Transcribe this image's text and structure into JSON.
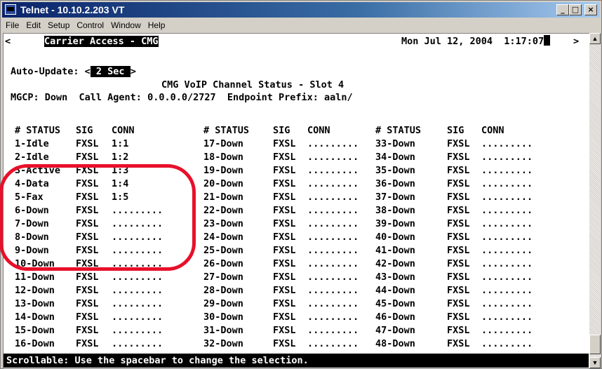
{
  "window": {
    "title": "Telnet - 10.10.2.203 VT",
    "controls": {
      "minimize": "_",
      "maximize": "□",
      "close": "×"
    }
  },
  "menu": [
    "File",
    "Edit",
    "Setup",
    "Control",
    "Window",
    "Help"
  ],
  "terminal": {
    "left_marker": "<",
    "right_marker": ">",
    "banner": "Carrier Access - CMG",
    "datetime": "Mon Jul 12, 2004  1:17:07",
    "auto_update_label": "Auto-Update: <",
    "auto_update_value": " 2 Sec ",
    "auto_update_end": ">",
    "screen_title": "CMG VoIP Channel Status - Slot 4",
    "mgcp_line": "MGCP: Down  Call Agent: 0.0.0.0/2727  Endpoint Prefix: aaln/",
    "headers": [
      "# STATUS",
      "SIG",
      "CONN"
    ],
    "columns": [
      [
        {
          "status": "1-Idle",
          "sig": "FXSL",
          "conn": "1:1"
        },
        {
          "status": "2-Idle",
          "sig": "FXSL",
          "conn": "1:2"
        },
        {
          "status": "3-Active",
          "sig": "FXSL",
          "conn": "1:3"
        },
        {
          "status": "4-Data",
          "sig": "FXSL",
          "conn": "1:4"
        },
        {
          "status": "5-Fax",
          "sig": "FXSL",
          "conn": "1:5"
        },
        {
          "status": "6-Down",
          "sig": "FXSL",
          "conn": "........."
        },
        {
          "status": "7-Down",
          "sig": "FXSL",
          "conn": "........."
        },
        {
          "status": "8-Down",
          "sig": "FXSL",
          "conn": "........."
        },
        {
          "status": "9-Down",
          "sig": "FXSL",
          "conn": "........."
        },
        {
          "status": "10-Down",
          "sig": "FXSL",
          "conn": "........."
        },
        {
          "status": "11-Down",
          "sig": "FXSL",
          "conn": "........."
        },
        {
          "status": "12-Down",
          "sig": "FXSL",
          "conn": "........."
        },
        {
          "status": "13-Down",
          "sig": "FXSL",
          "conn": "........."
        },
        {
          "status": "14-Down",
          "sig": "FXSL",
          "conn": "........."
        },
        {
          "status": "15-Down",
          "sig": "FXSL",
          "conn": "........."
        },
        {
          "status": "16-Down",
          "sig": "FXSL",
          "conn": "........."
        }
      ],
      [
        {
          "status": "17-Down",
          "sig": "FXSL",
          "conn": "........."
        },
        {
          "status": "18-Down",
          "sig": "FXSL",
          "conn": "........."
        },
        {
          "status": "19-Down",
          "sig": "FXSL",
          "conn": "........."
        },
        {
          "status": "20-Down",
          "sig": "FXSL",
          "conn": "........."
        },
        {
          "status": "21-Down",
          "sig": "FXSL",
          "conn": "........."
        },
        {
          "status": "22-Down",
          "sig": "FXSL",
          "conn": "........."
        },
        {
          "status": "23-Down",
          "sig": "FXSL",
          "conn": "........."
        },
        {
          "status": "24-Down",
          "sig": "FXSL",
          "conn": "........."
        },
        {
          "status": "25-Down",
          "sig": "FXSL",
          "conn": "........."
        },
        {
          "status": "26-Down",
          "sig": "FXSL",
          "conn": "........."
        },
        {
          "status": "27-Down",
          "sig": "FXSL",
          "conn": "........."
        },
        {
          "status": "28-Down",
          "sig": "FXSL",
          "conn": "........."
        },
        {
          "status": "29-Down",
          "sig": "FXSL",
          "conn": "........."
        },
        {
          "status": "30-Down",
          "sig": "FXSL",
          "conn": "........."
        },
        {
          "status": "31-Down",
          "sig": "FXSL",
          "conn": "........."
        },
        {
          "status": "32-Down",
          "sig": "FXSL",
          "conn": "........."
        }
      ],
      [
        {
          "status": "33-Down",
          "sig": "FXSL",
          "conn": "........."
        },
        {
          "status": "34-Down",
          "sig": "FXSL",
          "conn": "........."
        },
        {
          "status": "35-Down",
          "sig": "FXSL",
          "conn": "........."
        },
        {
          "status": "36-Down",
          "sig": "FXSL",
          "conn": "........."
        },
        {
          "status": "37-Down",
          "sig": "FXSL",
          "conn": "........."
        },
        {
          "status": "38-Down",
          "sig": "FXSL",
          "conn": "........."
        },
        {
          "status": "39-Down",
          "sig": "FXSL",
          "conn": "........."
        },
        {
          "status": "40-Down",
          "sig": "FXSL",
          "conn": "........."
        },
        {
          "status": "41-Down",
          "sig": "FXSL",
          "conn": "........."
        },
        {
          "status": "42-Down",
          "sig": "FXSL",
          "conn": "........."
        },
        {
          "status": "43-Down",
          "sig": "FXSL",
          "conn": "........."
        },
        {
          "status": "44-Down",
          "sig": "FXSL",
          "conn": "........."
        },
        {
          "status": "45-Down",
          "sig": "FXSL",
          "conn": "........."
        },
        {
          "status": "46-Down",
          "sig": "FXSL",
          "conn": "........."
        },
        {
          "status": "47-Down",
          "sig": "FXSL",
          "conn": "........."
        },
        {
          "status": "48-Down",
          "sig": "FXSL",
          "conn": "........."
        }
      ]
    ],
    "status_line": "Scrollable: Use the spacebar to change the selection."
  },
  "colors": {
    "highlight_circle": "#e8102a",
    "titlebar": "#0a246a"
  }
}
